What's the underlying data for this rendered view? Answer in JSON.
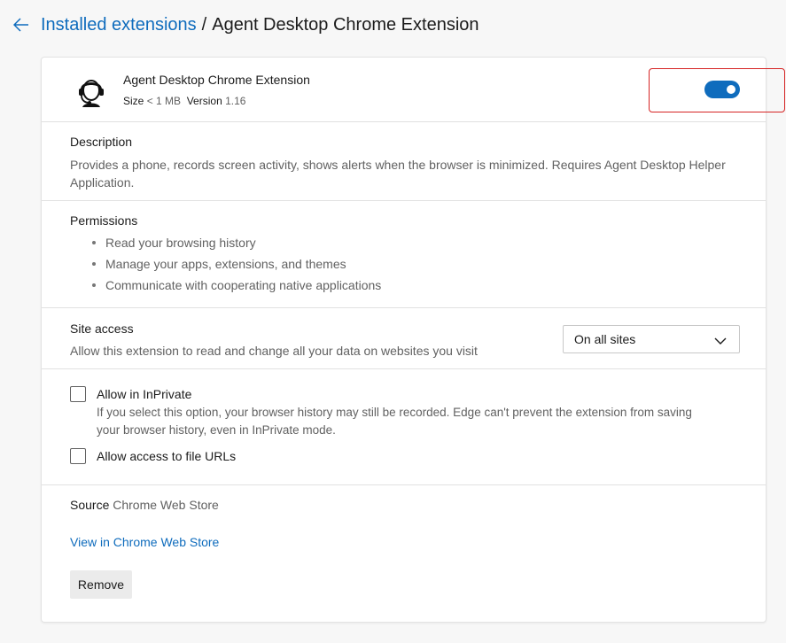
{
  "header": {
    "breadcrumb_link": "Installed extensions",
    "breadcrumb_separator": "/",
    "breadcrumb_current": "Agent Desktop Chrome Extension"
  },
  "extension": {
    "name": "Agent Desktop Chrome Extension",
    "size_label": "Size",
    "size_value": "< 1 MB",
    "version_label": "Version",
    "version_value": "1.16",
    "enabled": true,
    "icon": "headset-user-icon"
  },
  "description": {
    "title": "Description",
    "line1": "Provides a phone, records screen activity, shows alerts when the browser is minimized. Requires Agent Desktop Helper",
    "line2": "Application."
  },
  "permissions": {
    "title": "Permissions",
    "items": [
      "Read your browsing history",
      "Manage your apps, extensions, and themes",
      "Communicate with cooperating native applications"
    ]
  },
  "site_access": {
    "title": "Site access",
    "text": "Allow this extension to read and change all your data on websites you visit",
    "selected": "On all sites"
  },
  "options": {
    "inprivate_label": "Allow in InPrivate",
    "inprivate_checked": false,
    "inprivate_help_line1": "If you select this option, your browser history may still be recorded. Edge can't prevent the extension from saving",
    "inprivate_help_line2": "your browser history, even in InPrivate mode.",
    "file_urls_label": "Allow access to file URLs",
    "file_urls_checked": false
  },
  "source": {
    "label": "Source",
    "value": "Chrome Web Store",
    "store_link": "View in Chrome Web Store",
    "remove_label": "Remove"
  },
  "colors": {
    "accent": "#0f6cbd",
    "highlight": "#d62424"
  }
}
